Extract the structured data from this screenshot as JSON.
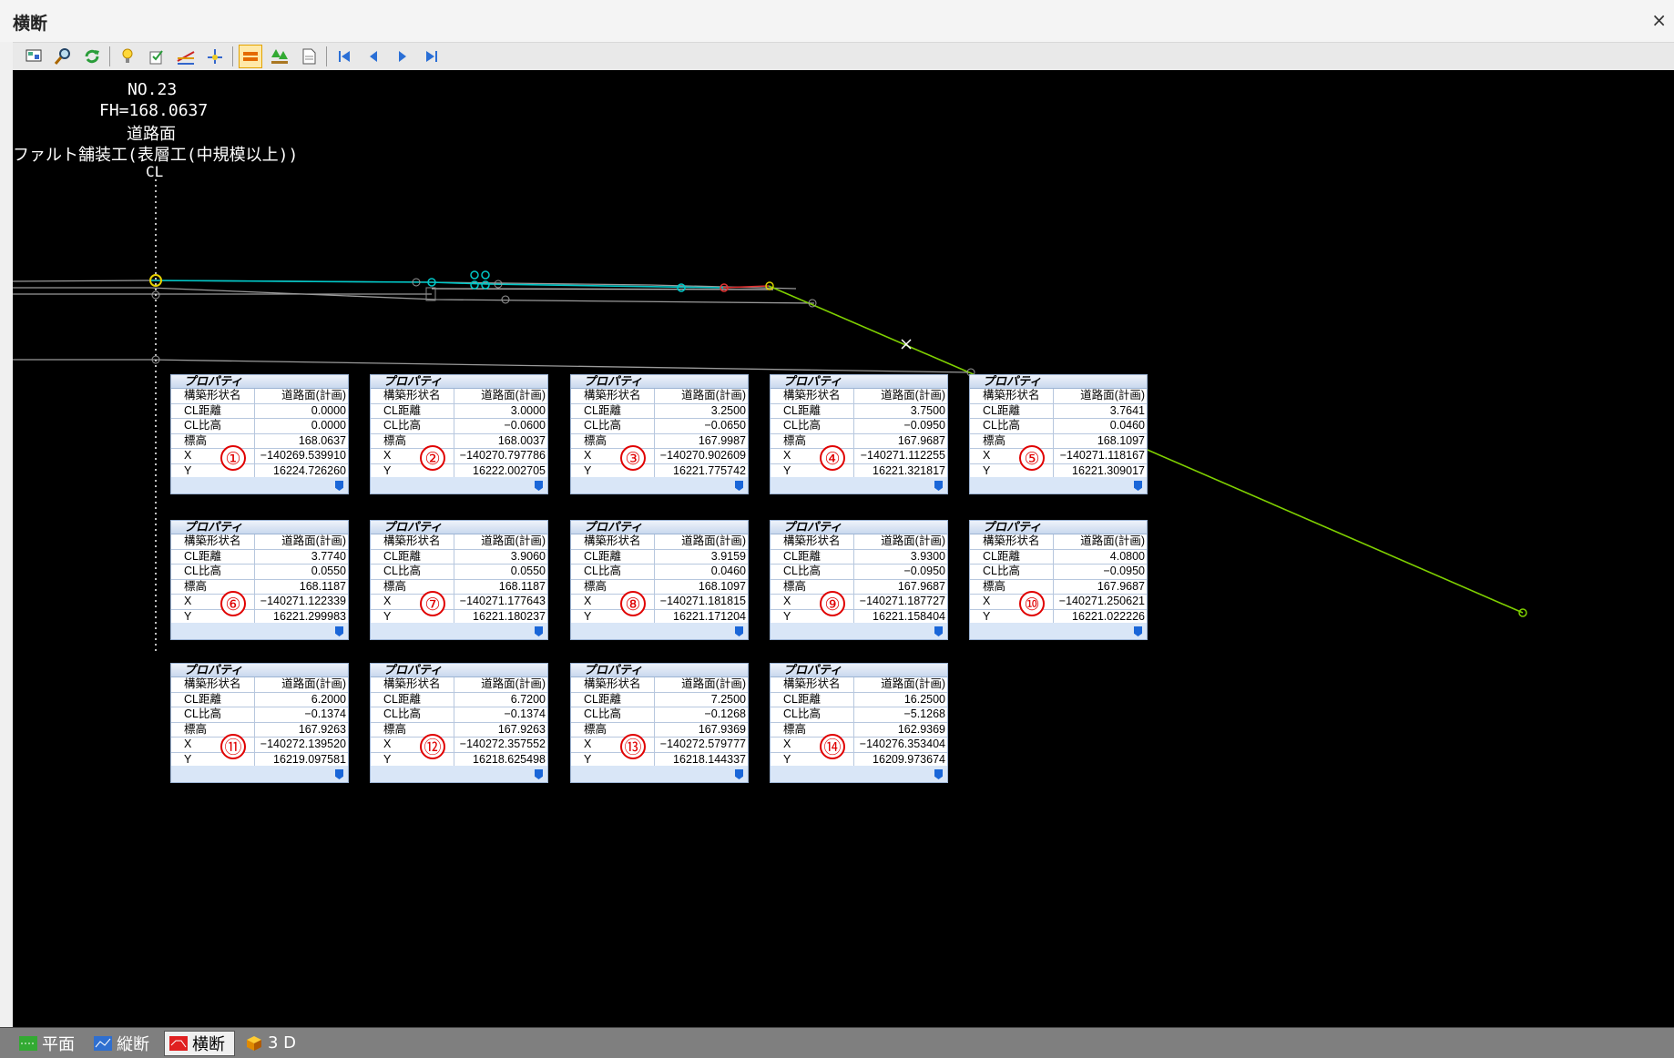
{
  "window": {
    "title": "横断",
    "close": "×"
  },
  "toolbar": {
    "buttons": [
      {
        "name": "display-icon"
      },
      {
        "name": "zoom-icon"
      },
      {
        "name": "refresh-icon"
      },
      {
        "name": "lightbulb-icon"
      },
      {
        "name": "settings-icon"
      },
      {
        "name": "section-line-icon"
      },
      {
        "name": "point-edit-icon"
      },
      {
        "name": "layers-icon",
        "active": true
      },
      {
        "name": "tree-icon"
      },
      {
        "name": "document-icon"
      },
      {
        "name": "first-icon"
      },
      {
        "name": "prev-icon"
      },
      {
        "name": "next-icon"
      },
      {
        "name": "last-icon"
      }
    ]
  },
  "header": {
    "station": "NO.23",
    "fh": "FH=168.0637",
    "surface": "道路面",
    "work": "ファルト舗装工(表層工(中規模以上))",
    "cl": "CL"
  },
  "labels": [
    "構築形状名",
    "CL距離",
    "CL比高",
    "標高",
    "X",
    "Y"
  ],
  "panel_title": "プロパティ",
  "panels": [
    {
      "n": "①",
      "name": "道路面(計画)",
      "cl_dist": "0.0000",
      "cl_height": "0.0000",
      "elev": "168.0637",
      "x": "−140269.539910",
      "y": "16224.726260"
    },
    {
      "n": "②",
      "name": "道路面(計画)",
      "cl_dist": "3.0000",
      "cl_height": "−0.0600",
      "elev": "168.0037",
      "x": "−140270.797786",
      "y": "16222.002705"
    },
    {
      "n": "③",
      "name": "道路面(計画)",
      "cl_dist": "3.2500",
      "cl_height": "−0.0650",
      "elev": "167.9987",
      "x": "−140270.902609",
      "y": "16221.775742"
    },
    {
      "n": "④",
      "name": "道路面(計画)",
      "cl_dist": "3.7500",
      "cl_height": "−0.0950",
      "elev": "167.9687",
      "x": "−140271.112255",
      "y": "16221.321817"
    },
    {
      "n": "⑤",
      "name": "道路面(計画)",
      "cl_dist": "3.7641",
      "cl_height": "0.0460",
      "elev": "168.1097",
      "x": "−140271.118167",
      "y": "16221.309017"
    },
    {
      "n": "⑥",
      "name": "道路面(計画)",
      "cl_dist": "3.7740",
      "cl_height": "0.0550",
      "elev": "168.1187",
      "x": "−140271.122339",
      "y": "16221.299983"
    },
    {
      "n": "⑦",
      "name": "道路面(計画)",
      "cl_dist": "3.9060",
      "cl_height": "0.0550",
      "elev": "168.1187",
      "x": "−140271.177643",
      "y": "16221.180237"
    },
    {
      "n": "⑧",
      "name": "道路面(計画)",
      "cl_dist": "3.9159",
      "cl_height": "0.0460",
      "elev": "168.1097",
      "x": "−140271.181815",
      "y": "16221.171204"
    },
    {
      "n": "⑨",
      "name": "道路面(計画)",
      "cl_dist": "3.9300",
      "cl_height": "−0.0950",
      "elev": "167.9687",
      "x": "−140271.187727",
      "y": "16221.158404"
    },
    {
      "n": "⑩",
      "name": "道路面(計画)",
      "cl_dist": "4.0800",
      "cl_height": "−0.0950",
      "elev": "167.9687",
      "x": "−140271.250621",
      "y": "16221.022226"
    },
    {
      "n": "⑪",
      "name": "道路面(計画)",
      "cl_dist": "6.2000",
      "cl_height": "−0.1374",
      "elev": "167.9263",
      "x": "−140272.139520",
      "y": "16219.097581"
    },
    {
      "n": "⑫",
      "name": "道路面(計画)",
      "cl_dist": "6.7200",
      "cl_height": "−0.1374",
      "elev": "167.9263",
      "x": "−140272.357552",
      "y": "16218.625498"
    },
    {
      "n": "⑬",
      "name": "道路面(計画)",
      "cl_dist": "7.2500",
      "cl_height": "−0.1268",
      "elev": "167.9369",
      "x": "−140272.579777",
      "y": "16218.144337"
    },
    {
      "n": "⑭",
      "name": "道路面(計画)",
      "cl_dist": "16.2500",
      "cl_height": "−5.1268",
      "elev": "162.9369",
      "x": "−140276.353404",
      "y": "16209.973674"
    }
  ],
  "status_tabs": [
    {
      "label": "平面",
      "icon": "plan-icon",
      "active": false
    },
    {
      "label": "縦断",
      "icon": "profile-icon",
      "active": false
    },
    {
      "label": "横断",
      "icon": "cross-section-icon",
      "active": true
    },
    {
      "label": "3 D",
      "icon": "cube-icon",
      "active": false
    }
  ],
  "colors": {
    "background": "#000000",
    "design_line": "#7fd000",
    "road_line": "#00c8c8",
    "existing_line": "#9a9a9a",
    "marker": "#e00000"
  }
}
